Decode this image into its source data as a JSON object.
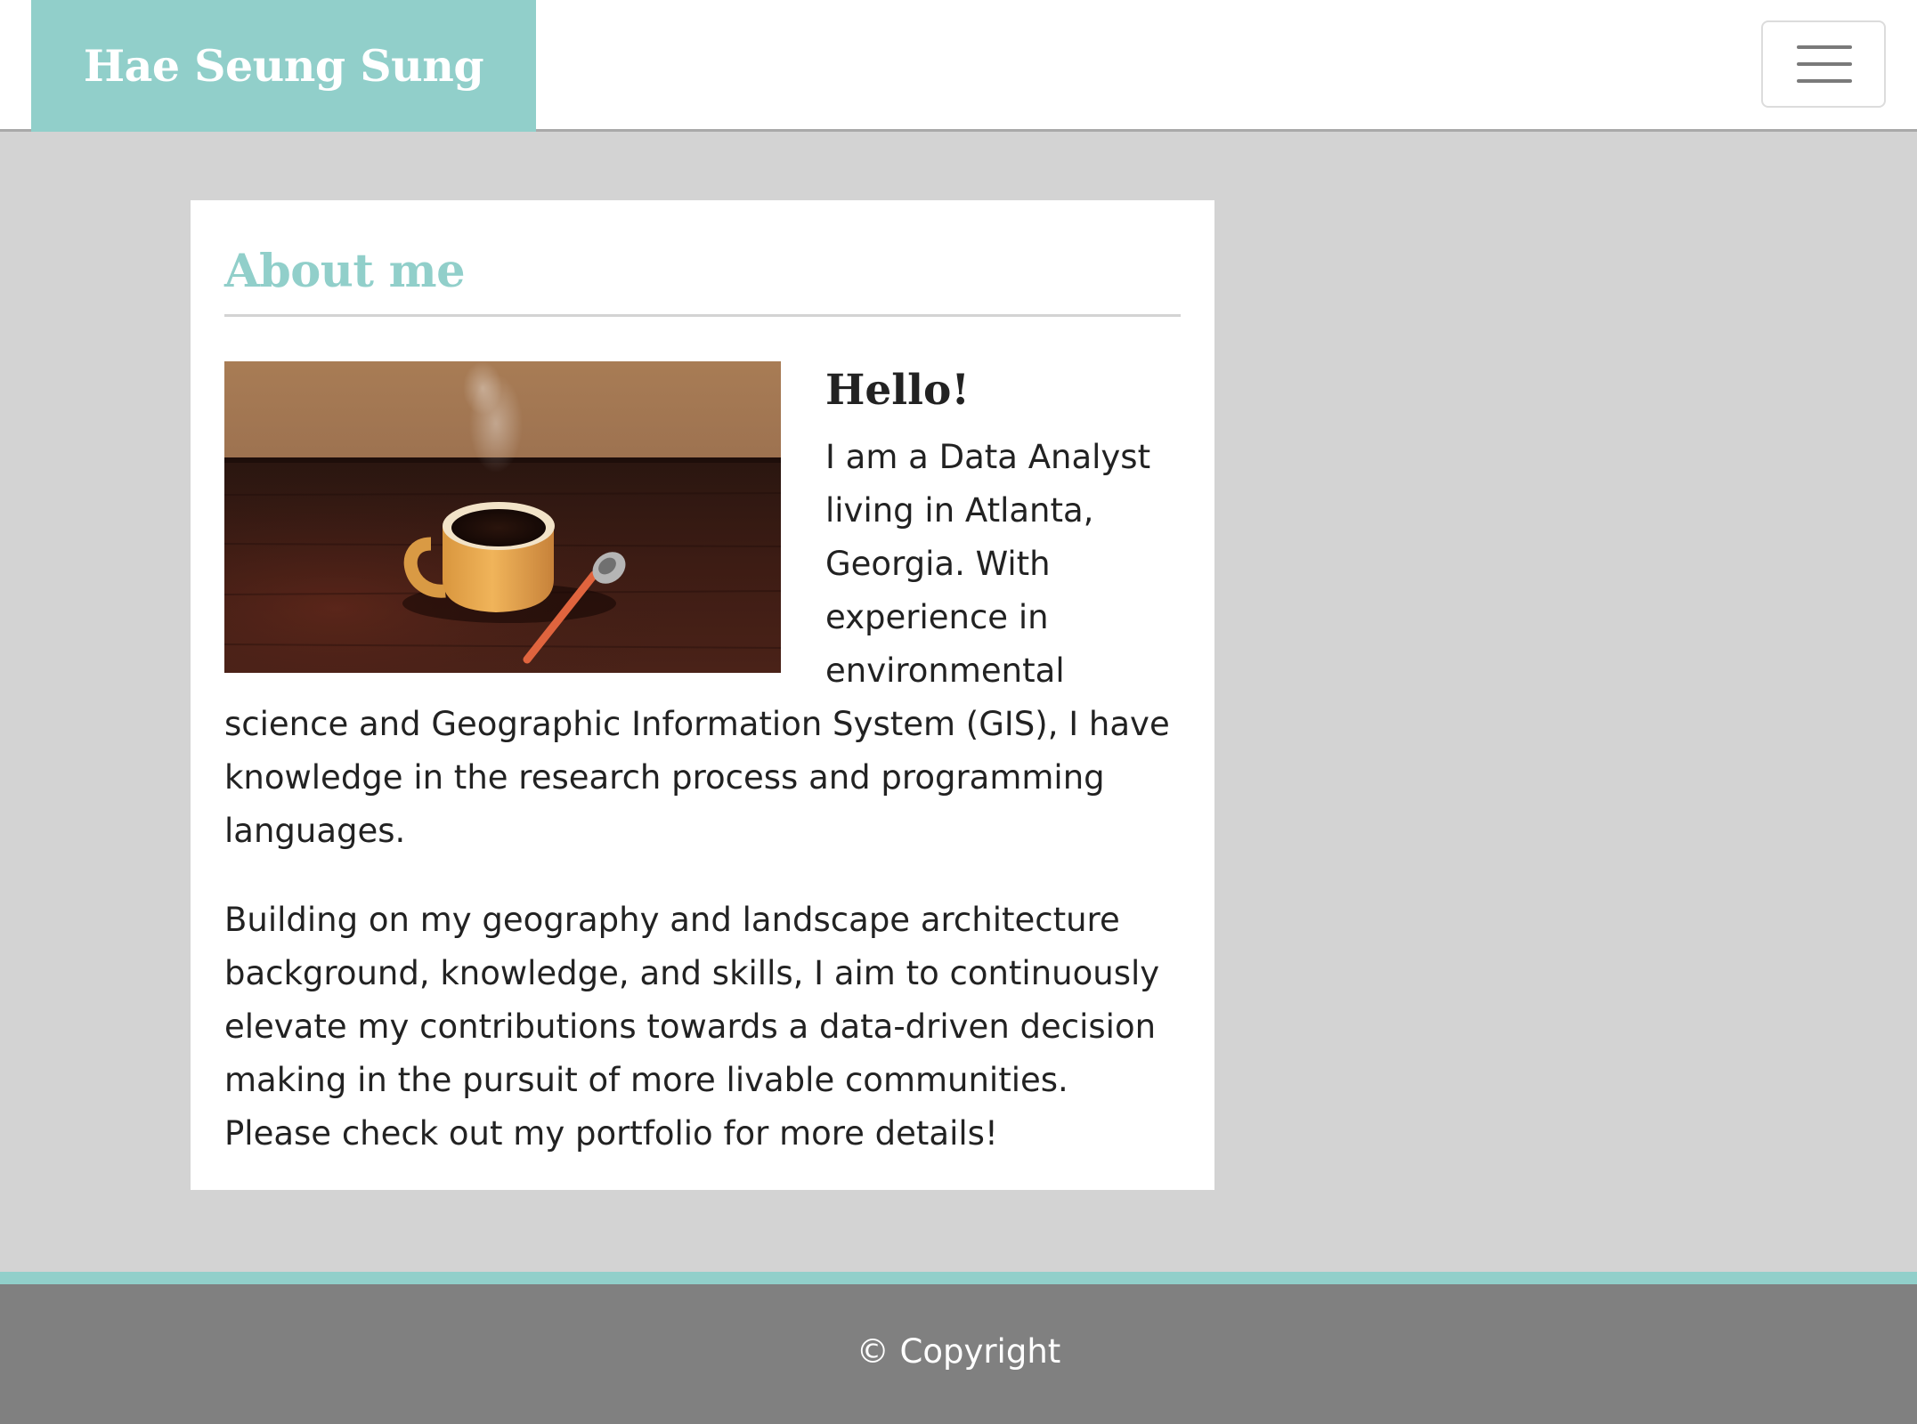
{
  "header": {
    "brand": "Hae Seung Sung",
    "menu_icon": "hamburger-menu-icon"
  },
  "about": {
    "section_title": "About me",
    "image": {
      "description_icon": "coffee-cup-photo"
    },
    "greeting": "Hello!",
    "paragraphs": [
      "I am a Data Analyst living in Atlanta, Georgia. With experience in environmental science and Geographic Information System (GIS), I have knowledge in the research process and programming languages.",
      "Building on my geography and landscape architecture background, knowledge, and skills, I aim to continuously elevate my contributions towards a data-driven decision making in the pursuit of more livable communities. Please check out my portfolio for more details!"
    ]
  },
  "footer": {
    "copyright": "© Copyright"
  },
  "colors": {
    "accent": "#91cfca",
    "page_background": "#d3d3d3",
    "footer_background": "#808080",
    "text": "#222222"
  }
}
